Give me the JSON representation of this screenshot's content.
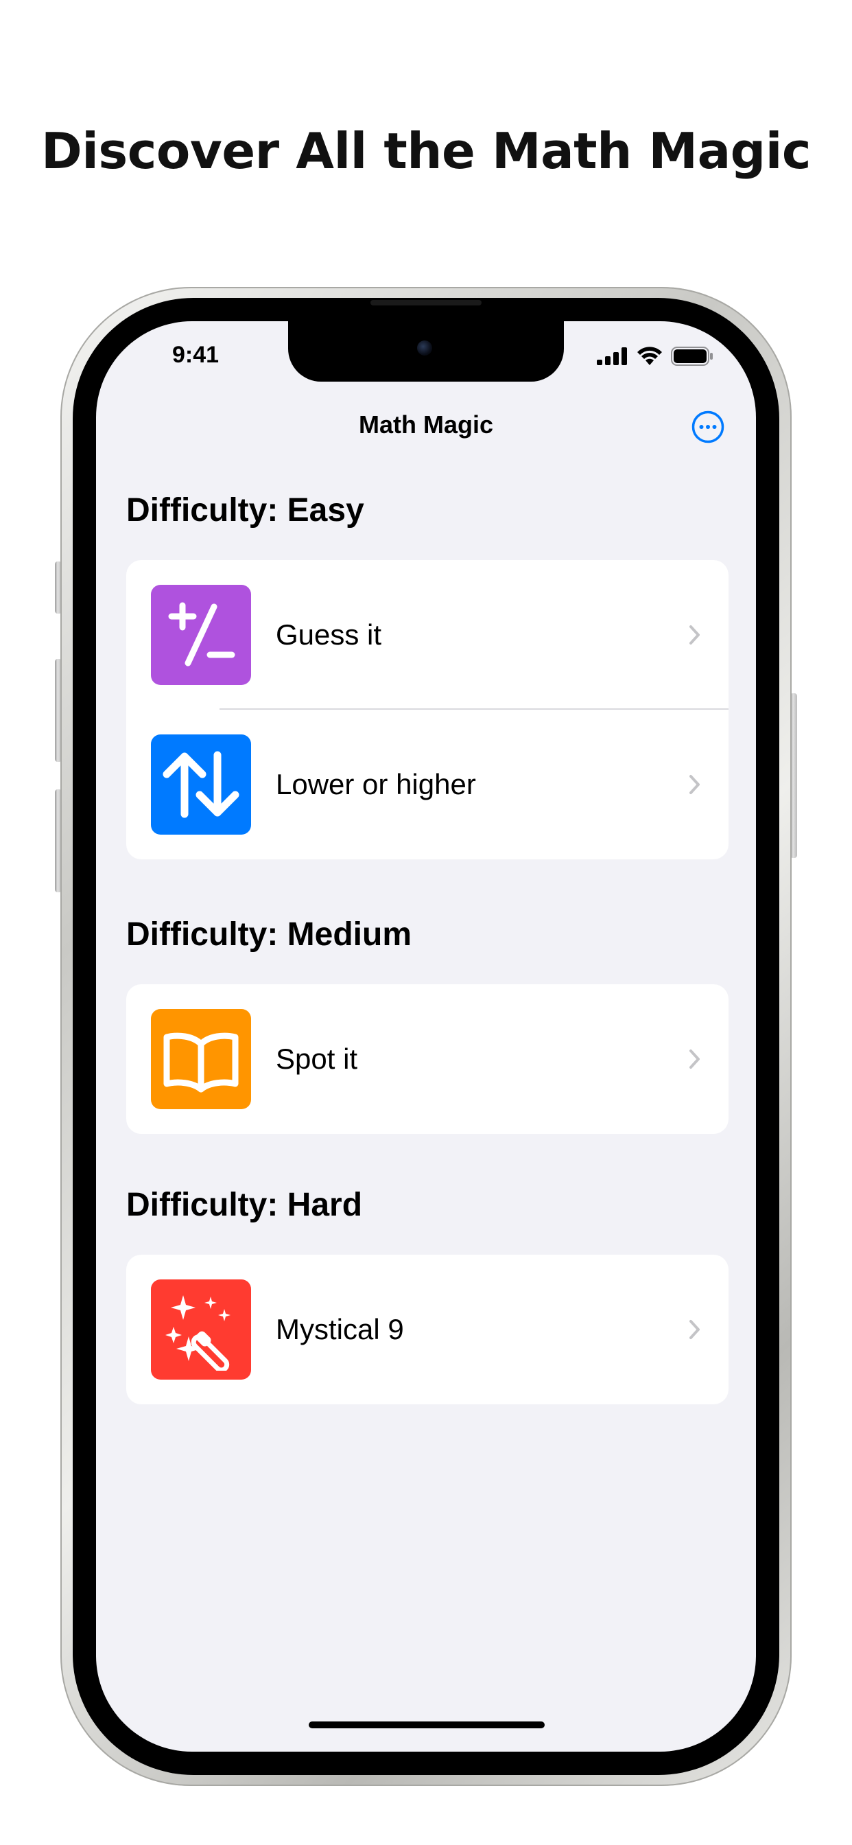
{
  "marketing": {
    "headline": "Discover All the Math Magic"
  },
  "status_bar": {
    "time": "9:41",
    "icons": [
      "cellular-signal-icon",
      "wifi-icon",
      "battery-icon"
    ]
  },
  "nav": {
    "title": "Math Magic",
    "more_icon": "ellipsis-circle-icon"
  },
  "sections": [
    {
      "header": "Difficulty: Easy",
      "items": [
        {
          "label": "Guess it",
          "icon": "plus-slash-minus-icon",
          "color": "#AF52DE"
        },
        {
          "label": "Lower or higher",
          "icon": "arrow-up-arrow-down-icon",
          "color": "#007AFF"
        }
      ]
    },
    {
      "header": "Difficulty: Medium",
      "items": [
        {
          "label": "Spot it",
          "icon": "book-icon",
          "color": "#FF9500"
        }
      ]
    },
    {
      "header": "Difficulty: Hard",
      "items": [
        {
          "label": "Mystical 9",
          "icon": "magic-wand-icon",
          "color": "#FF3B30"
        }
      ]
    }
  ],
  "colors": {
    "accent": "#007AFF",
    "background": "#F2F2F7",
    "chevron": "#C4C4C7"
  }
}
